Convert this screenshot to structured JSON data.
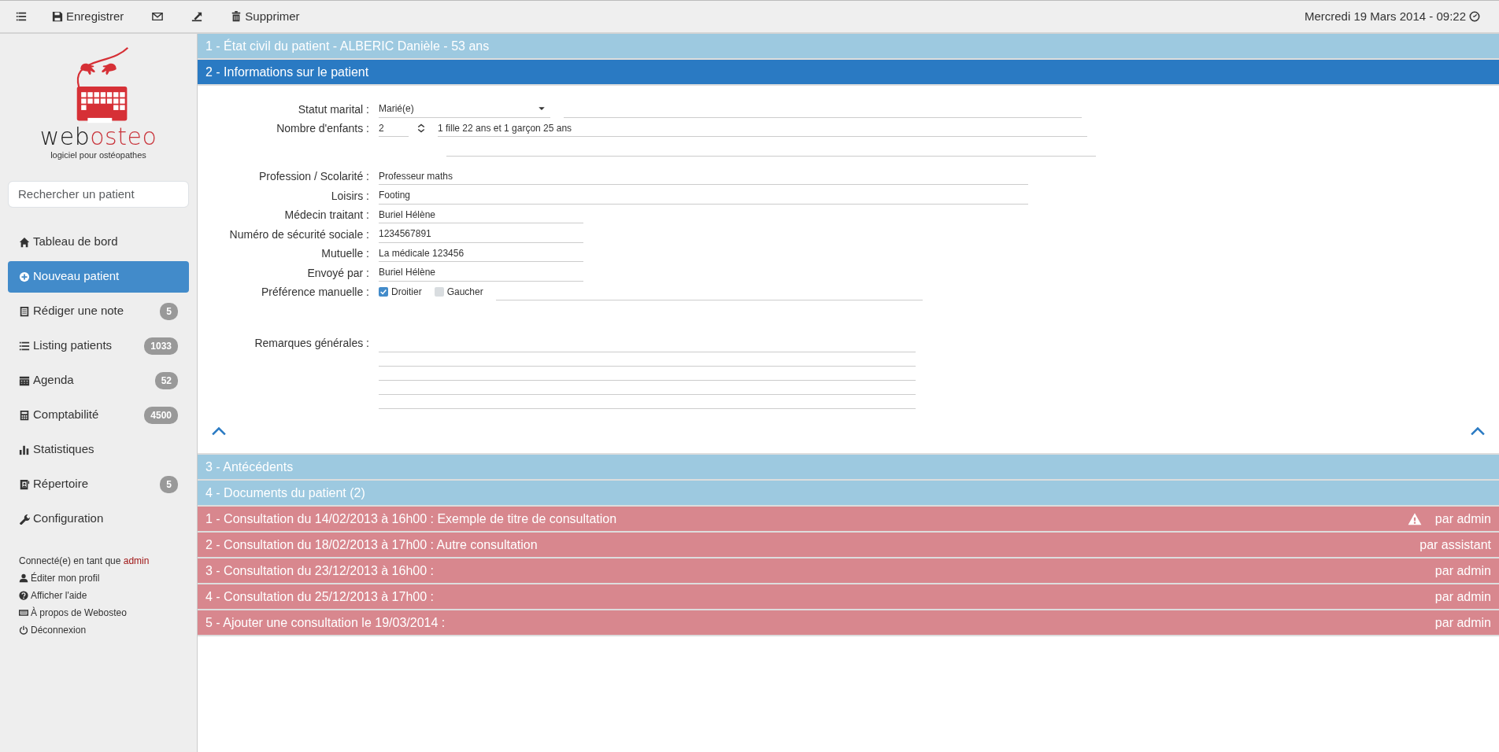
{
  "toolbar": {
    "save_label": "Enregistrer",
    "delete_label": "Supprimer",
    "datetime": "Mercredi 19 Mars 2014 - 09:22"
  },
  "sidebar": {
    "logo": {
      "word_start": "web",
      "word_end": "osteo",
      "tagline": "logiciel pour ostéopathes"
    },
    "search": {
      "placeholder": "Rechercher un patient"
    },
    "items": [
      {
        "label": "Tableau de bord",
        "selected": false
      },
      {
        "label": "Nouveau patient",
        "selected": true
      },
      {
        "label": "Rédiger une note",
        "badge": "5",
        "selected": false
      },
      {
        "label": "Listing patients",
        "badge": "1033",
        "selected": false
      },
      {
        "label": "Agenda",
        "badge": "52",
        "selected": false
      },
      {
        "label": "Comptabilité",
        "badge": "4500",
        "selected": false
      },
      {
        "label": "Statistiques",
        "selected": false
      },
      {
        "label": "Répertoire",
        "badge": "5",
        "selected": false
      },
      {
        "label": "Configuration",
        "selected": false
      }
    ],
    "session": {
      "prefix": "Connecté(e) en tant que",
      "user": "admin"
    },
    "links": [
      "Éditer mon profil",
      "Afficher l'aide",
      "À propos de Webosteo",
      "Déconnexion"
    ]
  },
  "sections": [
    {
      "title": "1 - État civil du patient - ALBERIC Danièle - 53 ans",
      "expanded": false
    },
    {
      "title": "2 - Informations sur le patient",
      "expanded": true
    }
  ],
  "form": {
    "fields": [
      {
        "kind": "select",
        "label": "Statut marital :",
        "value": "Marié(e)"
      },
      {
        "kind": "number",
        "label": "Nombre d'enfants :",
        "value": "2",
        "note": "1 fille 22 ans et 1 garçon 25 ans"
      },
      {
        "kind": "long",
        "label": "Profession / Scolarité :",
        "value": "Professeur maths"
      },
      {
        "kind": "long",
        "label": "Loisirs :",
        "value": "Footing"
      },
      {
        "kind": "short",
        "label": "Médecin traitant :",
        "value": "Buriel Hélène"
      },
      {
        "kind": "short",
        "label": "Numéro de sécurité sociale :",
        "value": "1234567891"
      },
      {
        "kind": "short",
        "label": "Mutuelle :",
        "value": "La médicale 123456"
      },
      {
        "kind": "short",
        "label": "Envoyé par :",
        "value": "Buriel Hélène"
      },
      {
        "kind": "choice",
        "label": "Préférence manuelle :",
        "options": [
          {
            "label": "Droitier",
            "checked": true
          },
          {
            "label": "Gaucher",
            "checked": false
          }
        ]
      },
      {
        "kind": "notes",
        "label": "Remarques générales :"
      }
    ]
  },
  "more_sections": [
    {
      "title": "3 - Antécédents",
      "expanded": false
    },
    {
      "title": "4 - Documents du patient (2)",
      "expanded": false
    }
  ],
  "consultations": [
    {
      "title": "1 - Consultation du 14/02/2013 à 16h00 : Exemple de titre de consultation",
      "author": "par admin",
      "warning": true
    },
    {
      "title": "2 - Consultation du 18/02/2013 à 17h00 : Autre consultation",
      "author": "par assistant",
      "warning": false
    },
    {
      "title": "3 - Consultation du 23/12/2013 à 16h00 :",
      "author": "par admin",
      "warning": false
    },
    {
      "title": "4 - Consultation du 25/12/2013 à 17h00 :",
      "author": "par admin",
      "warning": false
    },
    {
      "title": "5 - Ajouter une consultation le 19/03/2014 :",
      "author": "par admin",
      "warning": false
    }
  ]
}
